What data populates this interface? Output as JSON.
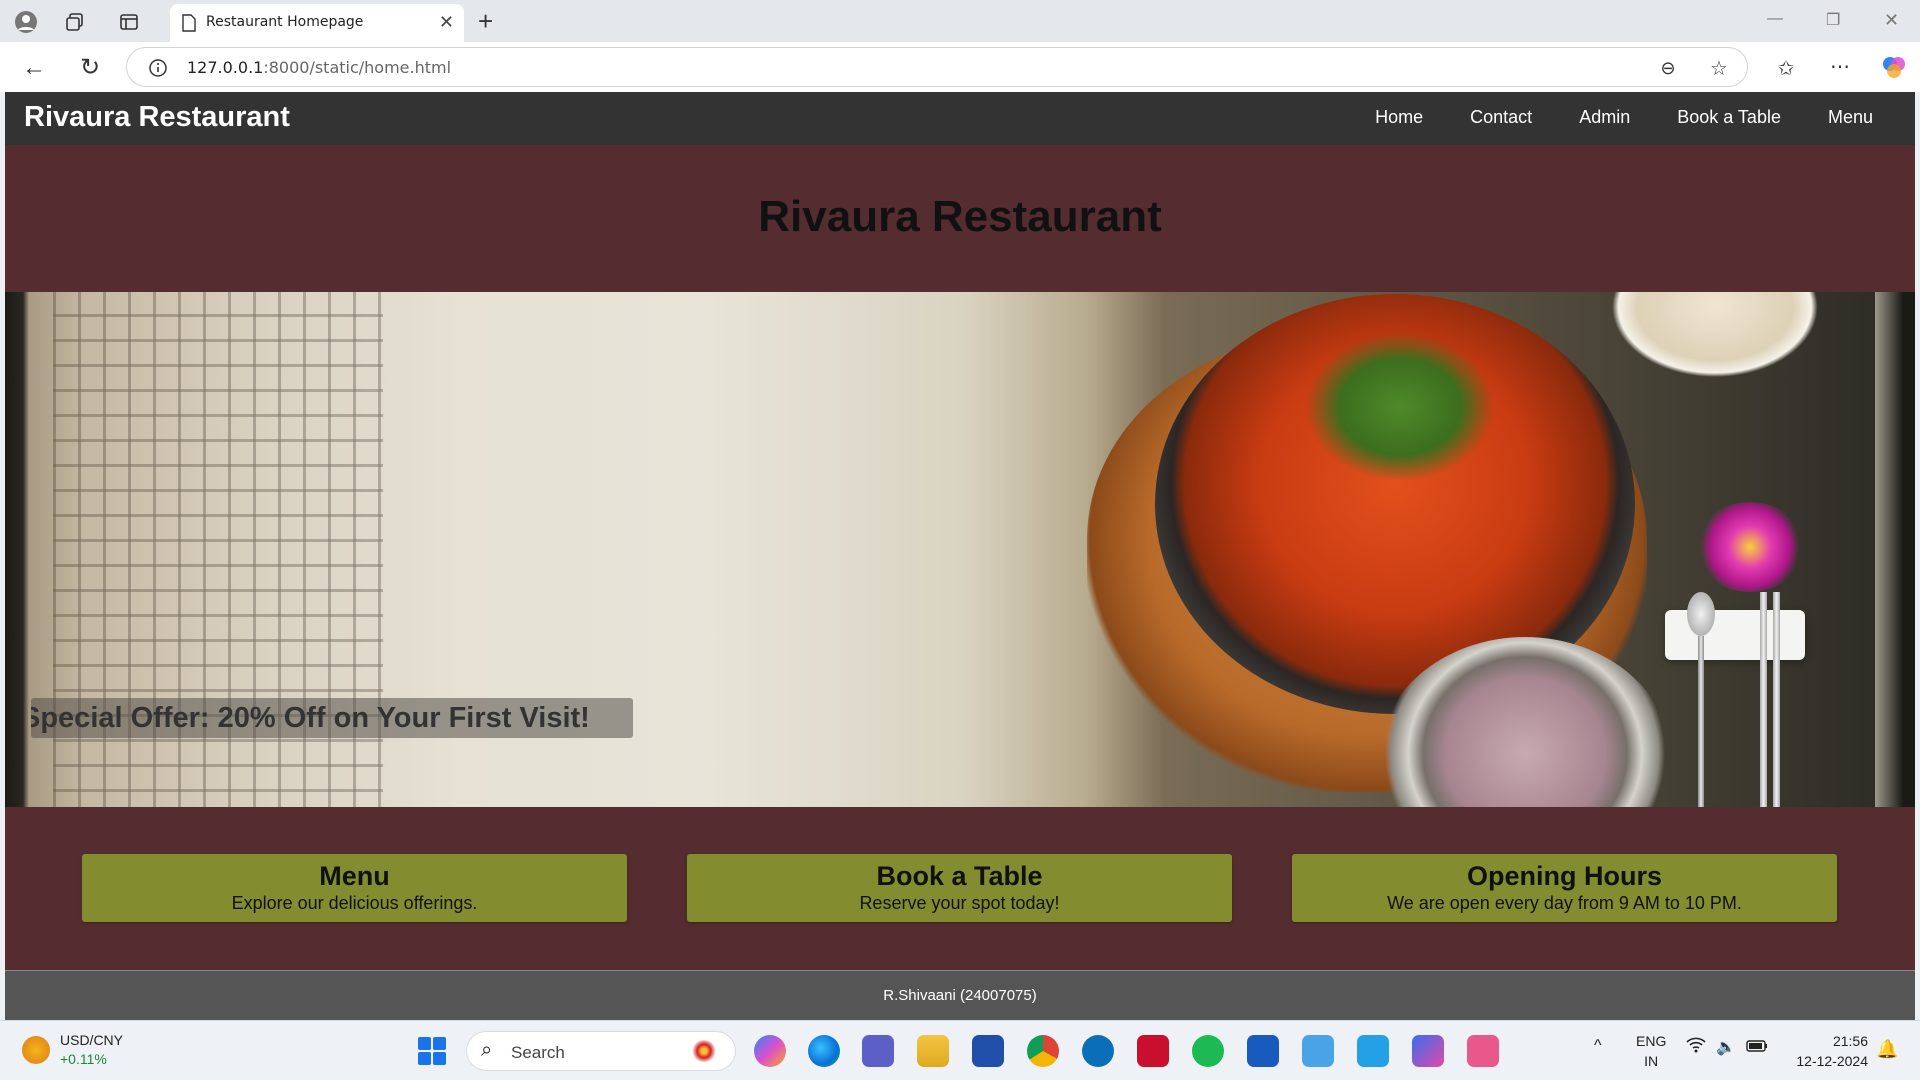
{
  "browser": {
    "tab_title": "Restaurant Homepage",
    "url_host": "127.0.0.1",
    "url_path": ":8000/static/home.html"
  },
  "site": {
    "brand": "Rivaura Restaurant",
    "nav": [
      "Home",
      "Contact",
      "Admin",
      "Book a Table",
      "Menu"
    ],
    "hero_title": "Rivaura Restaurant",
    "offer": "Special Offer: 20% Off on Your First Visit!",
    "cards": [
      {
        "title": "Menu",
        "subtitle": "Explore our delicious offerings."
      },
      {
        "title": "Book a Table",
        "subtitle": "Reserve your spot today!"
      },
      {
        "title": "Opening Hours",
        "subtitle": "We are open every day from 9 AM to 10 PM."
      }
    ],
    "footer": "R.Shivaani (24007075)"
  },
  "taskbar": {
    "widget_label": "USD/CNY",
    "widget_change": "+0.11%",
    "search_label": "Search",
    "lang_1": "ENG",
    "lang_2": "IN",
    "time": "21:56",
    "date": "12-12-2024"
  },
  "colors": {
    "page_bg": "#552d30",
    "navbar": "#333333",
    "card": "#848c30",
    "footer": "#555555"
  }
}
